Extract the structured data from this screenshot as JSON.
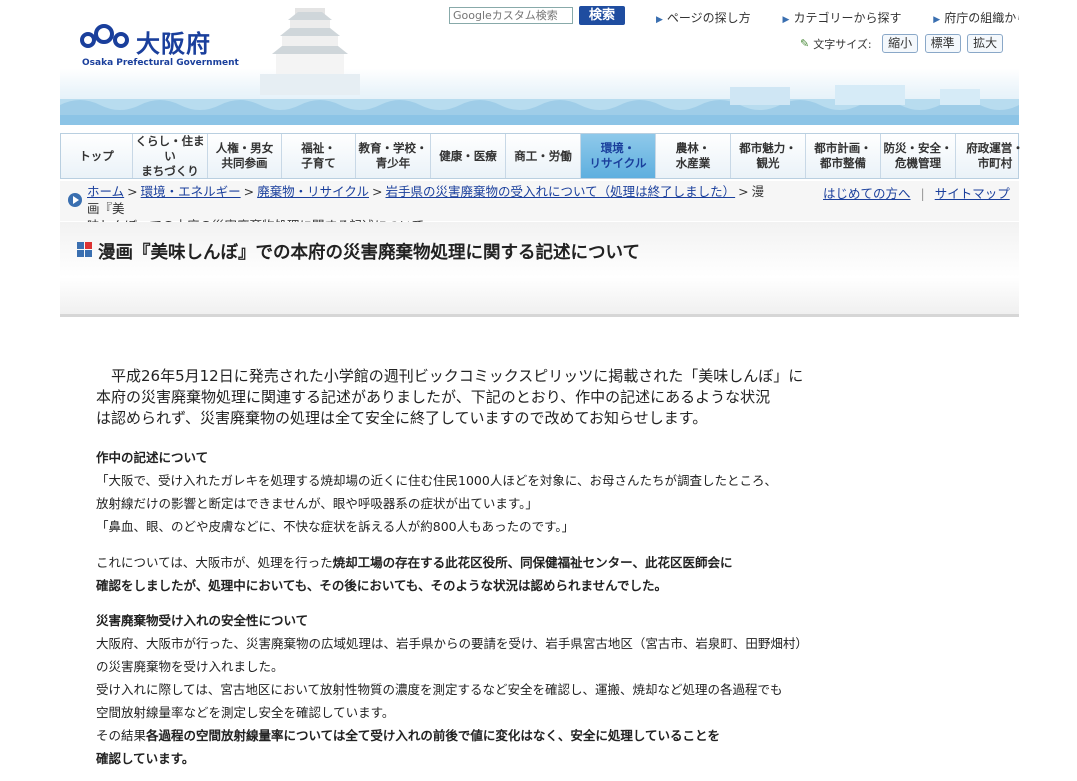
{
  "header": {
    "logo_text": "大阪府",
    "logo_sub": "Osaka Prefectural Government",
    "search_placeholder": "Googleカスタム検索",
    "search_button": "検索",
    "top_links": [
      "ページの探し方",
      "カテゴリーから探す",
      "府庁の組織から探す"
    ],
    "font_size_label": "文字サイズ:",
    "font_size_buttons": [
      "縮小",
      "標準",
      "拡大"
    ]
  },
  "nav": {
    "items": [
      "トップ",
      "くらし・住まい\nまちづくり",
      "人権・男女\n共同参画",
      "福祉・\n子育て",
      "教育・学校・\n青少年",
      "健康・医療",
      "商工・労働",
      "環境・\nリサイクル",
      "農林・\n水産業",
      "都市魅力・\n観光",
      "都市計画・\n都市整備",
      "防災・安全・\n危機管理",
      "府政運営・\n市町村"
    ],
    "active_index": 7
  },
  "breadcrumb": {
    "links": [
      "ホーム",
      "環境・エネルギー",
      "廃棄物・リサイクル",
      "岩手県の災害廃棄物の受入れについて（処理は終了しました）"
    ],
    "current_a": "漫画『美",
    "current_b": "味しんぼ』での本府の災害廃棄物処理に関する記述について",
    "right_links": [
      "はじめての方へ",
      "サイトマップ"
    ]
  },
  "page_title": "漫画『美味しんぼ』での本府の災害廃棄物処理に関する記述について",
  "body": {
    "intro_lines": [
      "　平成26年5月12日に発売された小学館の週刊ビックコミックスピリッツに掲載された「美味しんぼ」に",
      "本府の災害廃棄物処理に関連する記述がありましたが、下記のとおり、作中の記述にあるような状況",
      "は認められず、災害廃棄物の処理は全て安全に終了していますので改めてお知らせします。"
    ],
    "section1": {
      "heading": "作中の記述について",
      "lines": [
        "「大阪で、受け入れたガレキを処理する焼却場の近くに住む住民1000人ほどを対象に、お母さんたちが調査したところ、",
        "放射線だけの影響と断定はできませんが、眼や呼吸器系の症状が出ています。」",
        "「鼻血、眼、のどや皮膚などに、不快な症状を訴える人が約800人もあったのです。」"
      ]
    },
    "section2": {
      "line1_normal": "これについては、大阪市が、処理を行った",
      "line1_bold": "焼却工場の存在する此花区役所、同保健福祉センター、此花区医師会に",
      "line2_bold": "確認をしましたが、処理中においても、その後においても、そのような状況は認められませんでした。"
    },
    "section3": {
      "heading": "災害廃棄物受け入れの安全性について",
      "lines": [
        "大阪府、大阪市が行った、災害廃棄物の広域処理は、岩手県からの要請を受け、岩手県宮古地区（宮古市、岩泉町、田野畑村）",
        "の災害廃棄物を受け入れました。",
        "受け入れに際しては、宮古地区において放射性物質の濃度を測定するなど安全を確認し、運搬、焼却など処理の各過程でも",
        "空間放射線量率などを測定し安全を確認しています。"
      ],
      "last_normal": "その結果",
      "last_bold": "各過程の空間放射線量率については全て受け入れの前後で値に変化はなく、安全に処理していることを",
      "last_bold2": "確認しています。"
    }
  }
}
